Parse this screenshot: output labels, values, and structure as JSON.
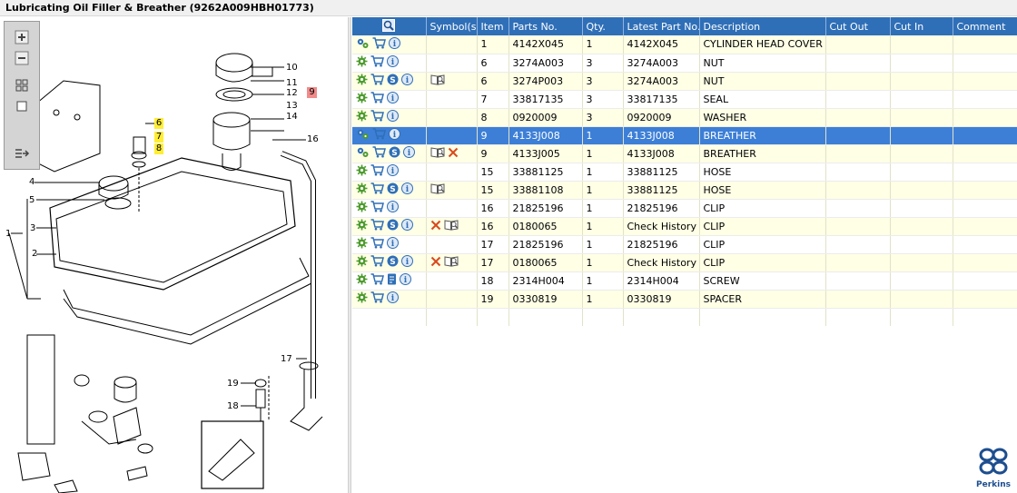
{
  "window": {
    "title": "Lubricating Oil Filler & Breather (9262A009HBH01773)"
  },
  "diagram": {
    "callouts": [
      "10",
      "11",
      "12",
      "9",
      "13",
      "14",
      "16",
      "6",
      "7",
      "8",
      "4",
      "5",
      "3",
      "1",
      "2",
      "17",
      "19",
      "18"
    ],
    "highlight_color": "#ffee33",
    "flag_color": "#f28a8a"
  },
  "zoom_toolbar": {
    "buttons": [
      "zoom-in-icon",
      "zoom-out-icon",
      "fit-page-icon",
      "actual-size-icon",
      "export-icon"
    ]
  },
  "grid": {
    "header_color": "#2f6fb7",
    "selected_color": "#3d7fd6",
    "columns": [
      "",
      "Symbol(s)",
      "Item",
      "Parts No.",
      "Qty.",
      "Latest Part No.",
      "Description",
      "Cut Out",
      "Cut In",
      "Comment"
    ],
    "rows": [
      {
        "actions": [
          "gears-icon",
          "cart-icon",
          "info-icon"
        ],
        "symbols": [],
        "item": "1",
        "part": "4142X045",
        "qty": "1",
        "latest": "4142X045",
        "desc": "CYLINDER HEAD COVER"
      },
      {
        "actions": [
          "gear-icon",
          "cart-icon",
          "info-icon"
        ],
        "symbols": [],
        "item": "6",
        "part": "3274A003",
        "qty": "3",
        "latest": "3274A003",
        "desc": "NUT"
      },
      {
        "actions": [
          "gear-icon",
          "cart-icon",
          "s-icon",
          "info-icon"
        ],
        "symbols": [
          "book-icon"
        ],
        "item": "6",
        "part": "3274P003",
        "qty": "3",
        "latest": "3274A003",
        "desc": "NUT"
      },
      {
        "actions": [
          "gear-icon",
          "cart-icon",
          "info-icon"
        ],
        "symbols": [],
        "item": "7",
        "part": "33817135",
        "qty": "3",
        "latest": "33817135",
        "desc": "SEAL"
      },
      {
        "actions": [
          "gear-icon",
          "cart-icon",
          "info-icon"
        ],
        "symbols": [],
        "item": "8",
        "part": "0920009",
        "qty": "3",
        "latest": "0920009",
        "desc": "WASHER"
      },
      {
        "actions": [
          "gears-icon",
          "cart-icon",
          "info-icon"
        ],
        "symbols": [],
        "item": "9",
        "part": "4133J008",
        "qty": "1",
        "latest": "4133J008",
        "desc": "BREATHER"
      },
      {
        "actions": [
          "gears-icon",
          "cart-icon",
          "s-icon",
          "info-icon"
        ],
        "symbols": [
          "book-icon",
          "cross-icon"
        ],
        "item": "9",
        "part": "4133J005",
        "qty": "1",
        "latest": "4133J008",
        "desc": "BREATHER"
      },
      {
        "actions": [
          "gear-icon",
          "cart-icon",
          "info-icon"
        ],
        "symbols": [],
        "item": "15",
        "part": "33881125",
        "qty": "1",
        "latest": "33881125",
        "desc": "HOSE"
      },
      {
        "actions": [
          "gear-icon",
          "cart-icon",
          "s-icon",
          "info-icon"
        ],
        "symbols": [
          "book-icon"
        ],
        "item": "15",
        "part": "33881108",
        "qty": "1",
        "latest": "33881125",
        "desc": "HOSE"
      },
      {
        "actions": [
          "gear-icon",
          "cart-icon",
          "info-icon"
        ],
        "symbols": [],
        "item": "16",
        "part": "21825196",
        "qty": "1",
        "latest": "21825196",
        "desc": "CLIP"
      },
      {
        "actions": [
          "gear-icon",
          "cart-icon",
          "s-icon",
          "info-icon"
        ],
        "symbols": [
          "cross-icon",
          "book-icon"
        ],
        "item": "16",
        "part": "0180065",
        "qty": "1",
        "latest": "Check History",
        "desc": "CLIP"
      },
      {
        "actions": [
          "gear-icon",
          "cart-icon",
          "info-icon"
        ],
        "symbols": [],
        "item": "17",
        "part": "21825196",
        "qty": "1",
        "latest": "21825196",
        "desc": "CLIP"
      },
      {
        "actions": [
          "gear-icon",
          "cart-icon",
          "s-icon",
          "info-icon"
        ],
        "symbols": [
          "cross-icon",
          "book-icon"
        ],
        "item": "17",
        "part": "0180065",
        "qty": "1",
        "latest": "Check History",
        "desc": "CLIP"
      },
      {
        "actions": [
          "gear-icon",
          "cart-icon",
          "doc-icon",
          "info-icon"
        ],
        "symbols": [],
        "item": "18",
        "part": "2314H004",
        "qty": "1",
        "latest": "2314H004",
        "desc": "SCREW"
      },
      {
        "actions": [
          "gear-icon",
          "cart-icon",
          "info-icon"
        ],
        "symbols": [],
        "item": "19",
        "part": "0330819",
        "qty": "1",
        "latest": "0330819",
        "desc": "SPACER"
      }
    ]
  },
  "logo": {
    "text": "Perkins"
  }
}
